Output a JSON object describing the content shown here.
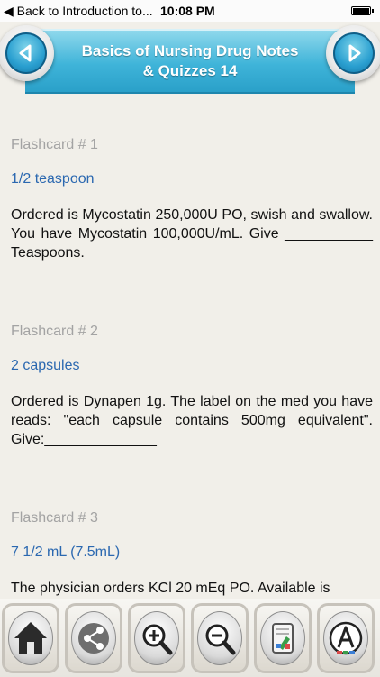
{
  "status_bar": {
    "back_label": "◀ Back to Introduction to...",
    "time": "10:08 PM"
  },
  "header": {
    "title": "Basics of Nursing Drug Notes & Quizzes 14",
    "left_icon": "chevron-left-icon",
    "right_icon": "chevron-right-icon",
    "accent_color": "#2aa0c9"
  },
  "cards": [
    {
      "label": "Flashcard # 1",
      "answer": "1/2 teaspoon",
      "question": "Ordered is Mycostatin 250,000U PO, swish and swallow. You have Mycostatin 100,000U/mL. Give ___________ Teaspoons."
    },
    {
      "label": "Flashcard # 2",
      "answer": "2 capsules",
      "question": "Ordered is Dynapen 1g. The label on the med you have reads: \"each capsule contains 500mg equivalent\". Give:______________"
    },
    {
      "label": "Flashcard # 3",
      "answer": "7 1/2 mL (7.5mL)",
      "question": "The physician orders KCl 20 mEq PO. Available is"
    }
  ],
  "toolbar": {
    "icons": [
      "home-icon",
      "share-icon",
      "zoom-in-icon",
      "zoom-out-icon",
      "highlighter-icon",
      "font-icon"
    ]
  }
}
